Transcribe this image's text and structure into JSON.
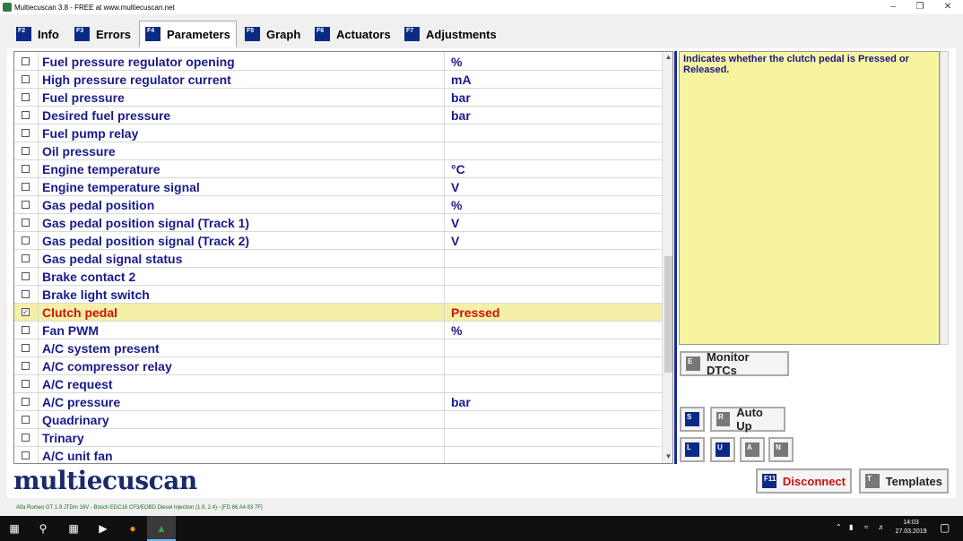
{
  "window": {
    "title": "Multiecuscan 3.8 - FREE at www.multiecuscan.net"
  },
  "tabs": [
    {
      "key": "F2",
      "label": "Info"
    },
    {
      "key": "F3",
      "label": "Errors"
    },
    {
      "key": "F4",
      "label": "Parameters"
    },
    {
      "key": "F5",
      "label": "Graph"
    },
    {
      "key": "F6",
      "label": "Actuators"
    },
    {
      "key": "F7",
      "label": "Adjustments"
    }
  ],
  "parameters": [
    {
      "name": "Fuel pressure regulator opening",
      "value": "%",
      "checked": false
    },
    {
      "name": "High pressure regulator current",
      "value": "mA",
      "checked": false
    },
    {
      "name": "Fuel pressure",
      "value": "bar",
      "checked": false
    },
    {
      "name": "Desired fuel pressure",
      "value": "bar",
      "checked": false
    },
    {
      "name": "Fuel pump relay",
      "value": "",
      "checked": false
    },
    {
      "name": "Oil pressure",
      "value": "",
      "checked": false
    },
    {
      "name": "Engine temperature",
      "value": "°C",
      "checked": false
    },
    {
      "name": "Engine temperature signal",
      "value": "V",
      "checked": false
    },
    {
      "name": "Gas pedal position",
      "value": "%",
      "checked": false
    },
    {
      "name": "Gas pedal position signal (Track 1)",
      "value": "V",
      "checked": false
    },
    {
      "name": "Gas pedal position signal (Track 2)",
      "value": "V",
      "checked": false
    },
    {
      "name": "Gas pedal signal status",
      "value": "",
      "checked": false
    },
    {
      "name": "Brake contact 2",
      "value": "",
      "checked": false
    },
    {
      "name": "Brake light switch",
      "value": "",
      "checked": false
    },
    {
      "name": "Clutch pedal",
      "value": "Pressed",
      "checked": true
    },
    {
      "name": "Fan PWM",
      "value": "%",
      "checked": false
    },
    {
      "name": "A/C system present",
      "value": "",
      "checked": false
    },
    {
      "name": "A/C compressor relay",
      "value": "",
      "checked": false
    },
    {
      "name": "A/C request",
      "value": "",
      "checked": false
    },
    {
      "name": "A/C pressure",
      "value": "bar",
      "checked": false
    },
    {
      "name": "Quadrinary",
      "value": "",
      "checked": false
    },
    {
      "name": "Trinary",
      "value": "",
      "checked": false
    },
    {
      "name": "A/C unit fan",
      "value": "",
      "checked": false
    }
  ],
  "description": "Indicates whether the clutch pedal is Pressed or Released.",
  "buttons": {
    "monitor_dtcs": {
      "key": "E",
      "label": "Monitor DTCs"
    },
    "s_key": "S",
    "auto_up": {
      "key": "R",
      "label": "Auto Up"
    },
    "l_key": "L",
    "u_key": "U",
    "a_key": "A",
    "n_key": "N",
    "disconnect": {
      "key": "F11",
      "label": "Disconnect"
    },
    "templates": {
      "key": "T",
      "label": "Templates"
    }
  },
  "logo": "multiecuscan",
  "status": "Alfa Romeo GT 1.9 JTDm 16V - Bosch EDC16 CF3/EOBD Diesel Injection (1.9, 2.4) - [FD 86 A4 83 7F]",
  "taskbar": {
    "time": "14:03",
    "date": "27.03.2019"
  },
  "colors": {
    "accent": "#0b2a86",
    "highlight_row": "#f5f0a8",
    "highlight_text": "#d01010",
    "param_text": "#1a1a8a",
    "description_bg": "#f7f4a0"
  }
}
